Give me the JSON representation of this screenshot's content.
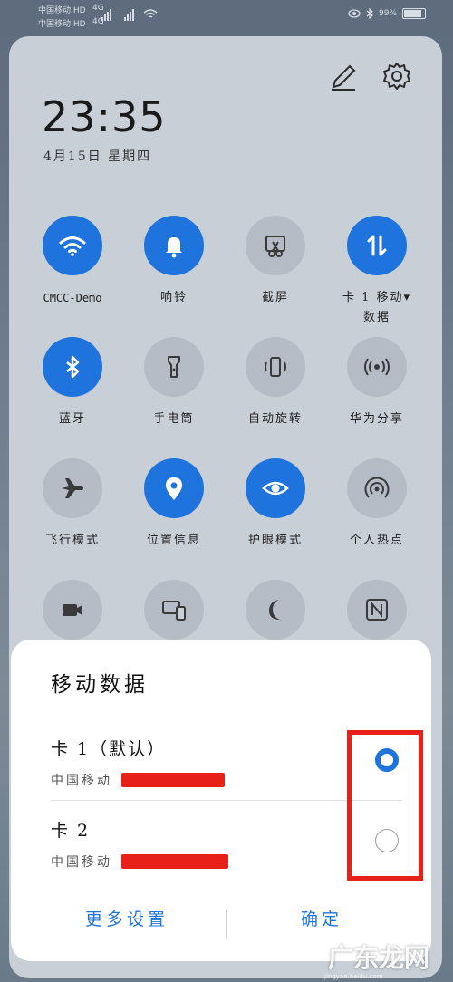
{
  "status_bar": {
    "carrier1": "中国移动 HD",
    "carrier2": "中国移动 HD",
    "net1": "4G",
    "net2": "4G",
    "battery": "99%"
  },
  "header": {
    "time": "23:35",
    "date": "4月15日 星期四"
  },
  "tiles": [
    {
      "label": "CMCC-Demo",
      "icon": "wifi-icon",
      "on": true
    },
    {
      "label": "响铃",
      "icon": "bell-icon",
      "on": true
    },
    {
      "label": "截屏",
      "icon": "screenshot-icon",
      "on": false
    },
    {
      "label": "卡 1 移动▾",
      "label2": "数据",
      "icon": "mobile-data-icon",
      "on": true
    },
    {
      "label": "蓝牙",
      "icon": "bluetooth-icon",
      "on": true
    },
    {
      "label": "手电筒",
      "icon": "flashlight-icon",
      "on": false
    },
    {
      "label": "自动旋转",
      "icon": "auto-rotate-icon",
      "on": false
    },
    {
      "label": "华为分享",
      "icon": "share-icon",
      "on": false
    },
    {
      "label": "飞行模式",
      "icon": "airplane-icon",
      "on": false
    },
    {
      "label": "位置信息",
      "icon": "location-icon",
      "on": true
    },
    {
      "label": "护眼模式",
      "icon": "eye-icon",
      "on": true
    },
    {
      "label": "个人热点",
      "icon": "hotspot-icon",
      "on": false
    },
    {
      "label": "",
      "icon": "screen-record-icon",
      "on": false
    },
    {
      "label": "",
      "icon": "multi-screen-icon",
      "on": false
    },
    {
      "label": "",
      "icon": "moon-icon",
      "on": false
    },
    {
      "label": "",
      "icon": "nfc-icon",
      "on": false
    }
  ],
  "sheet": {
    "title": "移动数据",
    "sims": [
      {
        "name": "卡 1（默认）",
        "carrier": "中国移动",
        "selected": true
      },
      {
        "name": "卡 2",
        "carrier": "中国移动",
        "selected": false
      }
    ],
    "more_settings": "更多设置",
    "confirm": "确定"
  },
  "watermark": {
    "text": "广东龙网",
    "url": "jingyan.baidu.com"
  },
  "colors": {
    "accent": "#1e73dc",
    "highlight": "#e8201a"
  }
}
